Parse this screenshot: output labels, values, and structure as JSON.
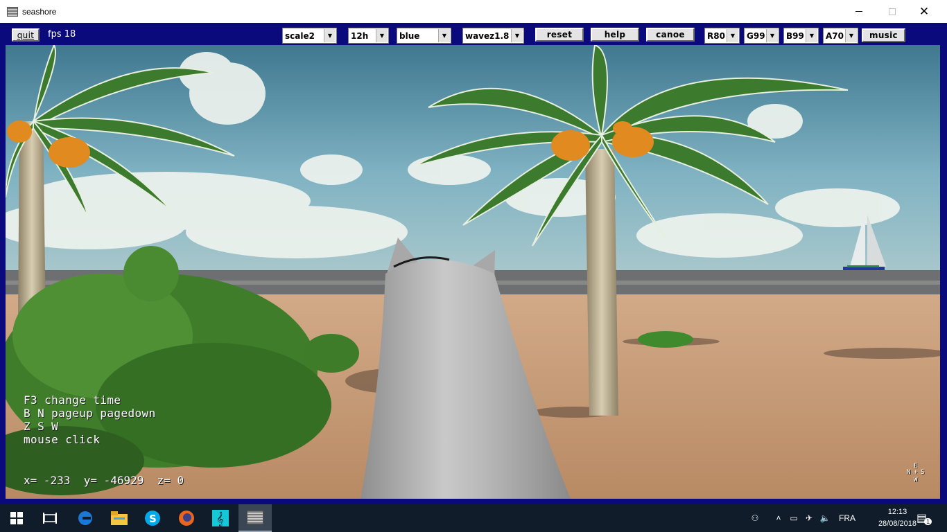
{
  "window": {
    "title": "seashore"
  },
  "toolbar": {
    "quit_label": "quit",
    "fps_label": "fps 18",
    "scale": "scale2",
    "time": "12h",
    "color": "blue",
    "wave": "wavez1.8",
    "reset_label": "reset",
    "help_label": "help",
    "canoe_label": "canoe",
    "r": "R80",
    "g": "G99",
    "b": "B99",
    "a": "A70",
    "music_label": "music",
    "colors": {
      "bar": "#0a0a7c",
      "button": "#e4e4e4"
    }
  },
  "scene": {
    "help_lines": [
      "F3 change time",
      "B N pageup pagedown",
      "Z S W",
      "mouse click"
    ],
    "coords": "x= -233  y= -46929  z= 0",
    "compass": {
      "n": "N",
      "e": "E",
      "s": "S",
      "w": "W"
    }
  },
  "taskbar": {
    "icons": [
      "windows-start-icon",
      "task-view-icon",
      "edge-icon",
      "file-explorer-icon",
      "skype-icon",
      "firefox-icon",
      "music-app-icon",
      "seashore-app-icon"
    ],
    "language": "FRA",
    "time": "12:13",
    "date": "28/08/2018",
    "notification_count": "1"
  }
}
